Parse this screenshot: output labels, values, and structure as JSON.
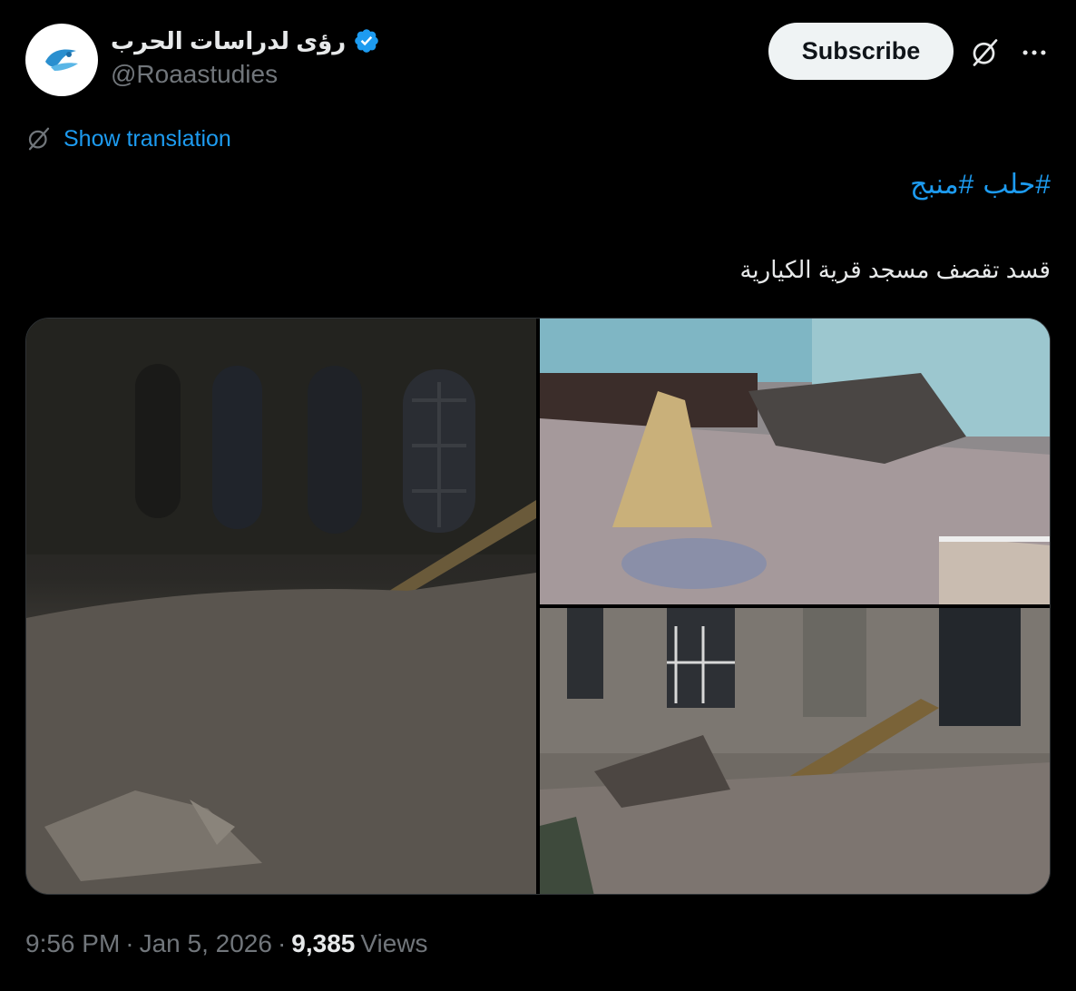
{
  "author": {
    "display_name": "رؤى لدراسات الحرب",
    "handle": "@Roaastudies",
    "verified": true,
    "avatar_icon": "roaa-logo-icon"
  },
  "actions": {
    "subscribe_label": "Subscribe",
    "grok_icon": "grok-icon",
    "more_icon": "more-icon"
  },
  "translation": {
    "label": "Show translation",
    "icon": "grok-icon"
  },
  "tweet": {
    "hashtags": [
      "#حلب",
      "#منبج"
    ],
    "text": "قسد تقصف مسجد قرية الكيارية"
  },
  "media": {
    "count": 3
  },
  "meta": {
    "time": "9:56 PM",
    "separator": "·",
    "date": "Jan 5, 2026",
    "views_count": "9,385",
    "views_label": "Views"
  },
  "colors": {
    "background": "#000000",
    "text_primary": "#e7e9ea",
    "text_secondary": "#71767b",
    "link": "#1d9bf0",
    "verified": "#1d9bf0",
    "subscribe_bg": "#eff3f4"
  }
}
